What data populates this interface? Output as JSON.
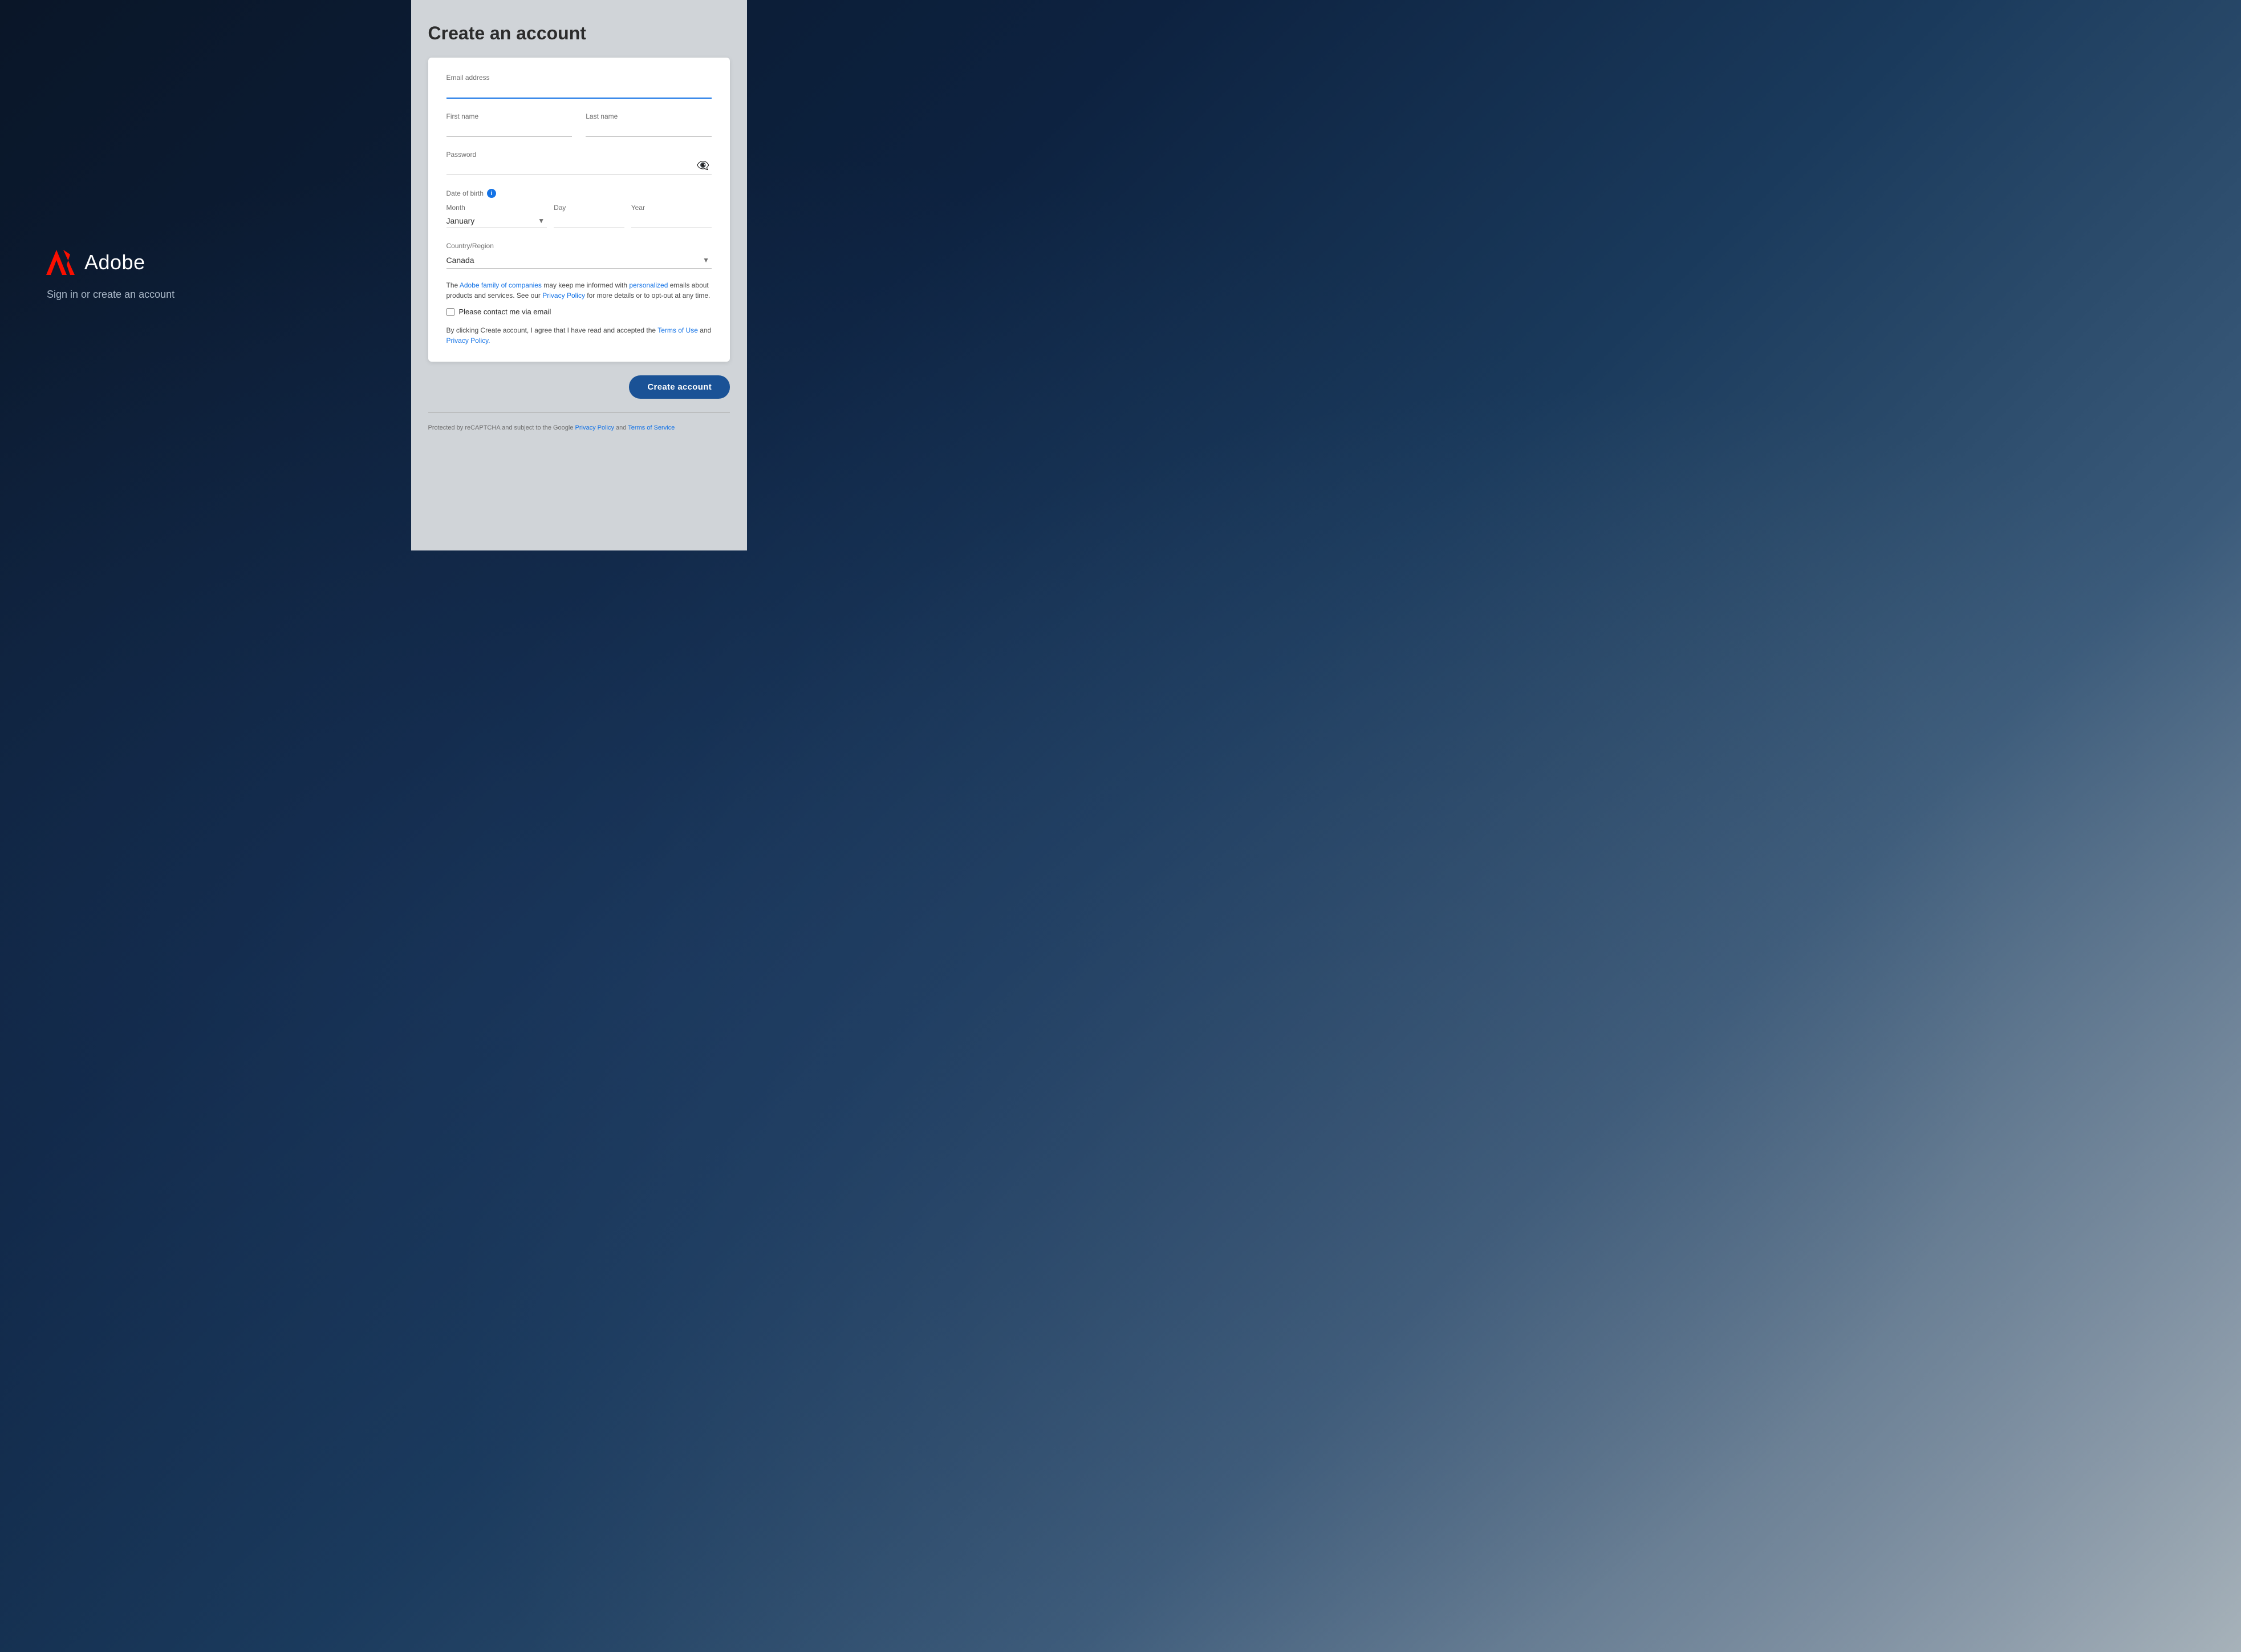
{
  "left": {
    "logo_name": "Adobe",
    "tagline": "Sign in or create an account"
  },
  "right": {
    "title": "Create an account",
    "form": {
      "email_label": "Email address",
      "email_placeholder": "",
      "first_name_label": "First name",
      "last_name_label": "Last name",
      "password_label": "Password",
      "dob_label": "Date of birth",
      "month_label": "Month",
      "day_label": "Day",
      "year_label": "Year",
      "month_value": "January",
      "country_label": "Country/Region",
      "country_value": "Canada",
      "consent_text_1": "The ",
      "consent_link1": "Adobe family of companies",
      "consent_text_2": " may keep me informed with ",
      "consent_link2": "personalized",
      "consent_text_3": " emails about products and services. See our ",
      "consent_link3": "Privacy Policy",
      "consent_text_4": " for more details or to opt-out at any time.",
      "checkbox_label": "Please contact me via email",
      "terms_text_1": "By clicking Create account, I agree that I have read and accepted the ",
      "terms_link1": "Terms of Use",
      "terms_text_2": " and ",
      "terms_link2": "Privacy Policy.",
      "create_button": "Create account"
    },
    "recaptcha": {
      "text1": "Protected by reCAPTCHA and subject to the Google ",
      "link1": "Privacy Policy",
      "text2": " and ",
      "link2": "Terms of Service"
    }
  }
}
